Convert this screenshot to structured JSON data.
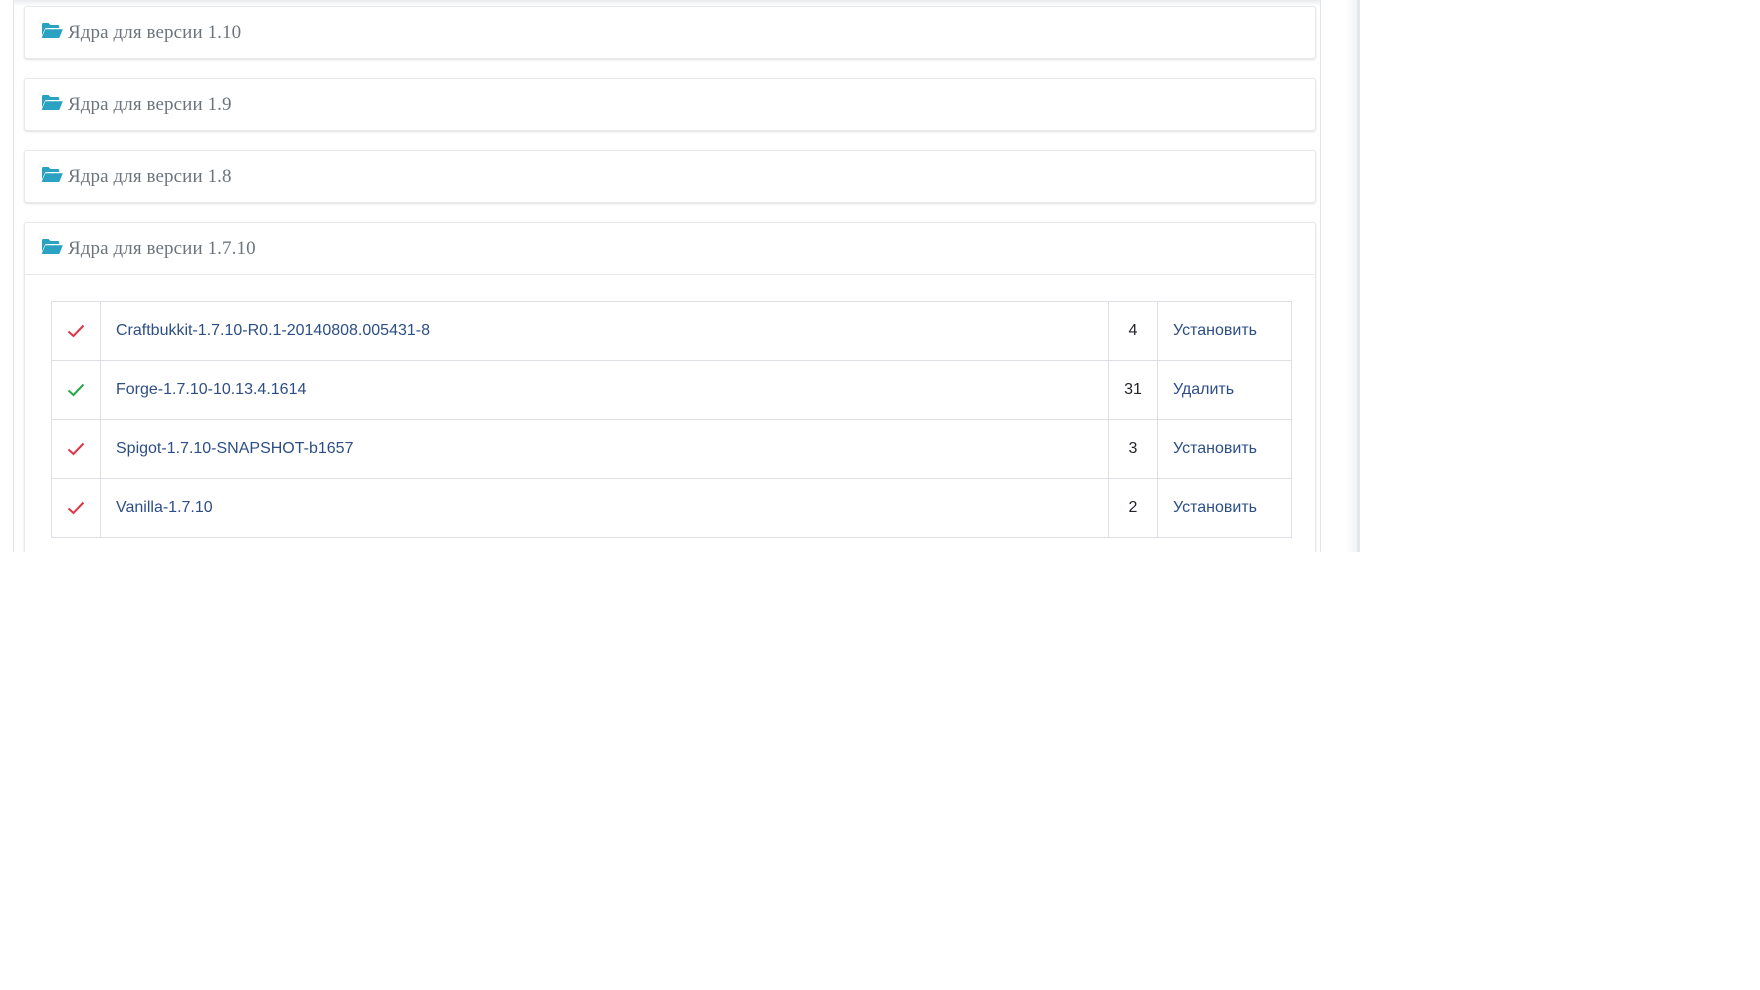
{
  "accordion": {
    "panels": [
      {
        "title": "Ядра для версии 1.10",
        "open": false
      },
      {
        "title": "Ядра для версии 1.9",
        "open": false
      },
      {
        "title": "Ядра для версии 1.8",
        "open": false
      },
      {
        "title": "Ядра для версии 1.7.10",
        "open": true
      }
    ]
  },
  "cores_1_7_10": {
    "rows": [
      {
        "status": "not-installed",
        "name": "Craftbukkit-1.7.10-R0.1-20140808.005431-8",
        "count": "4",
        "action": "Установить"
      },
      {
        "status": "installed",
        "name": "Forge-1.7.10-10.13.4.1614",
        "count": "31",
        "action": "Удалить"
      },
      {
        "status": "not-installed",
        "name": "Spigot-1.7.10-SNAPSHOT-b1657",
        "count": "3",
        "action": "Установить"
      },
      {
        "status": "not-installed",
        "name": "Vanilla-1.7.10",
        "count": "2",
        "action": "Установить"
      }
    ]
  },
  "colors": {
    "folder_icon": "#2aa3c2",
    "check_installed": "#28a745",
    "check_not_installed": "#dc3545",
    "link": "#2c4e86",
    "title": "#6c757d"
  },
  "icons": {
    "panel": "folder-open-icon",
    "status": "check-icon"
  }
}
